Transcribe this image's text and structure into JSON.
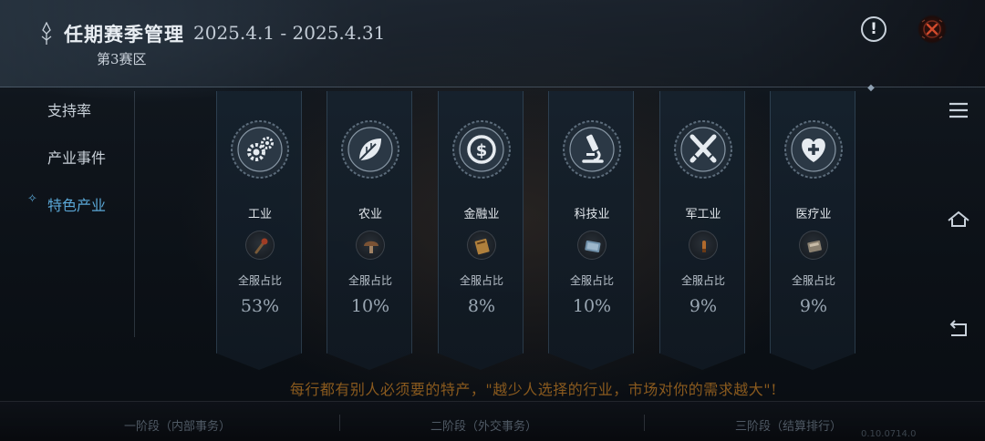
{
  "header": {
    "title": "任期赛季管理",
    "dates": "2025.4.1 - 2025.4.31",
    "subtitle": "第3赛区",
    "info_symbol": "!"
  },
  "sidebar": {
    "items": [
      {
        "label": "支持率",
        "active": false
      },
      {
        "label": "产业事件",
        "active": false
      },
      {
        "label": "特色产业",
        "active": true
      }
    ],
    "active_color": "#5aa7d6"
  },
  "industries": [
    {
      "name": "工业",
      "emblem": "gears-icon",
      "item_icon": "torch-icon",
      "share_label": "全服占比",
      "share": "53%"
    },
    {
      "name": "农业",
      "emblem": "leaf-icon",
      "item_icon": "mushroom-icon",
      "share_label": "全服占比",
      "share": "10%"
    },
    {
      "name": "金融业",
      "emblem": "coin-icon",
      "item_icon": "ledger-icon",
      "share_label": "全服占比",
      "share": "8%"
    },
    {
      "name": "科技业",
      "emblem": "microscope-icon",
      "item_icon": "tablet-icon",
      "share_label": "全服占比",
      "share": "10%"
    },
    {
      "name": "军工业",
      "emblem": "crossed-swords-icon",
      "item_icon": "bullet-icon",
      "share_label": "全服占比",
      "share": "9%"
    },
    {
      "name": "医疗业",
      "emblem": "medical-heart-icon",
      "item_icon": "medkit-icon",
      "share_label": "全服占比",
      "share": "9%"
    }
  ],
  "quote": "每行都有别人必须要的特产，\"越少人选择的行业，市场对你的需求越大\"!",
  "stages": [
    "一阶段（内部事务）",
    "二阶段（外交事务）",
    "三阶段（结算排行）"
  ],
  "version": "0.10.0714.0",
  "right_nav": [
    "menu-icon",
    "home-icon",
    "back-icon"
  ],
  "colors": {
    "accent": "#5aa7d6",
    "quote": "#8a5a1e",
    "close": "#c0392b"
  }
}
